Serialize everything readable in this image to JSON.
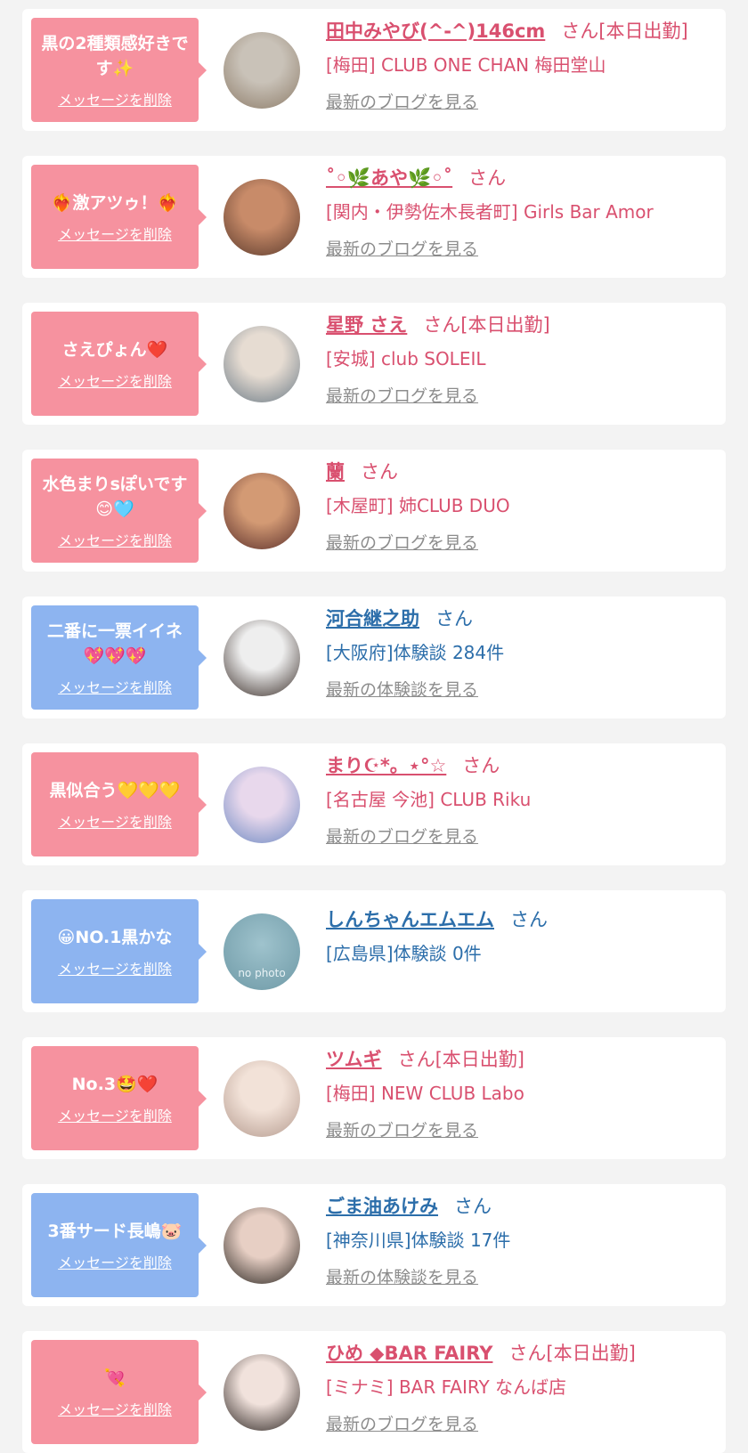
{
  "delete_label": "メッセージを削除",
  "colors": {
    "pink_bubble": "#f6929f",
    "blue_bubble": "#8db4f0",
    "pink_text": "#d9506f",
    "blue_text": "#2c6eaa"
  },
  "items": [
    {
      "type": "pink",
      "message": "黒の2種類感好きです✨",
      "name": "田中みやび(^-^)146cm",
      "suffix": "さん[本日出勤]",
      "location": "[梅田] CLUB ONE CHAN 梅田堂山",
      "link": "最新のブログを見る",
      "avatar": {
        "c1": "#c9c2b8",
        "c2": "#8d7c69"
      }
    },
    {
      "type": "pink",
      "message": "❤️‍🔥激アツゥ！❤️‍🔥",
      "name": "˚◦🌿あや🌿◦˚",
      "suffix": "さん",
      "location": "[関内・伊勢佐木長者町] Girls Bar Amor",
      "link": "最新のブログを見る",
      "avatar": {
        "c1": "#c88b69",
        "c2": "#5b3a2c"
      }
    },
    {
      "type": "pink",
      "message": "さえぴょん❤️",
      "name": "星野 さえ",
      "suffix": "さん[本日出勤]",
      "location": "[安城] club SOLEIL",
      "link": "最新のブログを見る",
      "avatar": {
        "c1": "#e6dcd2",
        "c2": "#6b7a86"
      }
    },
    {
      "type": "pink",
      "message": "水色まりsぽいです😊🩵",
      "name": "蘭",
      "suffix": "さん",
      "location": "[木屋町] 姉CLUB DUO",
      "link": "最新のブログを見る",
      "avatar": {
        "c1": "#d39a74",
        "c2": "#5a2e2a"
      }
    },
    {
      "type": "blue",
      "message": "二番に一票イイネ💖💖💖",
      "name": "河合継之助",
      "suffix": "さん",
      "location": "[大阪府]体験談 284件",
      "link": "最新の体験談を見る",
      "avatar": {
        "c1": "#eeeeee",
        "c2": "#3b2f2a"
      }
    },
    {
      "type": "pink",
      "message": "黒似合う💛💛💛",
      "name": "まり☪︎*。⋆°☆",
      "suffix": "さん",
      "location": "[名古屋 今池] CLUB Riku",
      "link": "最新のブログを見る",
      "avatar": {
        "c1": "#e8d8ec",
        "c2": "#6d89c2"
      }
    },
    {
      "type": "blue",
      "message": "😀NO.1黒かな",
      "name": "しんちゃんエムエム",
      "suffix": "さん",
      "location": "[広島県]体験談 0件",
      "link": "",
      "avatar": {
        "nophoto": "no photo"
      }
    },
    {
      "type": "pink",
      "message": "No.3🤩❤️",
      "name": "ツムギ",
      "suffix": "さん[本日出勤]",
      "location": "[梅田] NEW CLUB Labo",
      "link": "最新のブログを見る",
      "avatar": {
        "c1": "#f2e2d8",
        "c2": "#b49a8e"
      }
    },
    {
      "type": "blue",
      "message": "3番サード長嶋🐷",
      "name": "ごま油あけみ",
      "suffix": "さん",
      "location": "[神奈川県]体験談 17件",
      "link": "最新の体験談を見る",
      "avatar": {
        "c1": "#e7cfc4",
        "c2": "#2a2520"
      }
    },
    {
      "type": "pink",
      "message": "💘",
      "name": "ひめ ◆BAR FAIRY",
      "suffix": "さん[本日出勤]",
      "location": "[ミナミ] BAR FAIRY なんば店",
      "link": "最新のブログを見る",
      "avatar": {
        "c1": "#f1e2dc",
        "c2": "#2b2320"
      }
    }
  ]
}
